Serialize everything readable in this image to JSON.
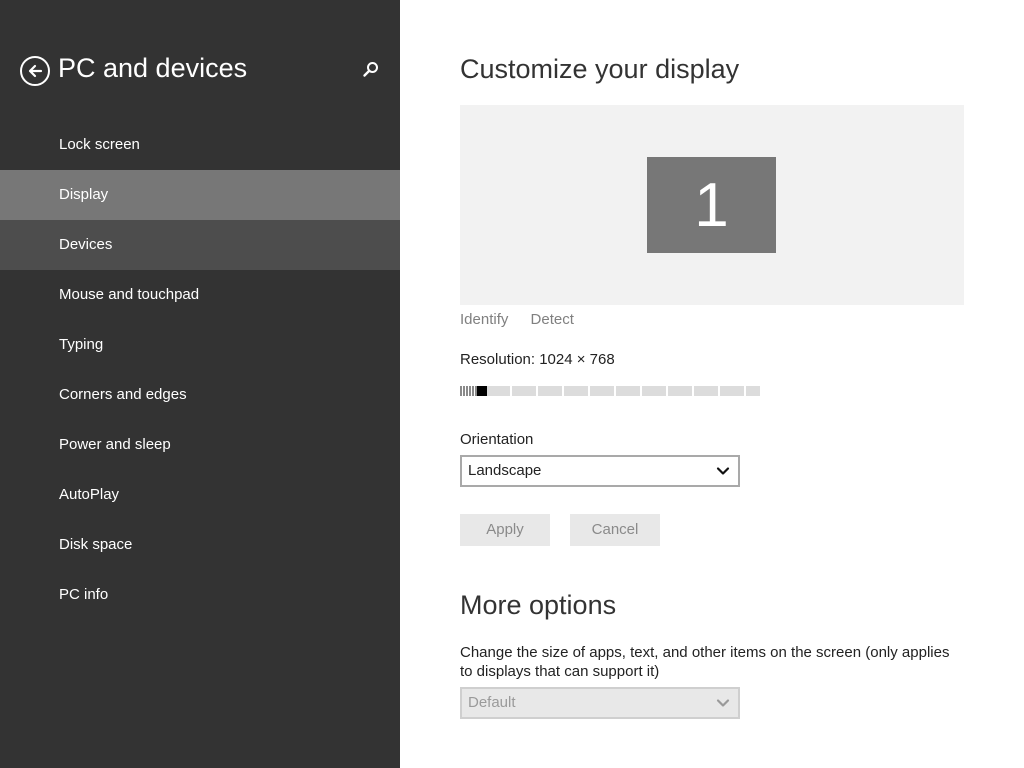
{
  "sidebar": {
    "title": "PC and devices",
    "back_icon": "back-arrow-icon",
    "search_icon": "search-icon",
    "items": [
      {
        "label": "Lock screen",
        "state": "normal"
      },
      {
        "label": "Display",
        "state": "selected"
      },
      {
        "label": "Devices",
        "state": "hover"
      },
      {
        "label": "Mouse and touchpad",
        "state": "normal"
      },
      {
        "label": "Typing",
        "state": "normal"
      },
      {
        "label": "Corners and edges",
        "state": "normal"
      },
      {
        "label": "Power and sleep",
        "state": "normal"
      },
      {
        "label": "AutoPlay",
        "state": "normal"
      },
      {
        "label": "Disk space",
        "state": "normal"
      },
      {
        "label": "PC info",
        "state": "normal"
      }
    ]
  },
  "main": {
    "title": "Customize your display",
    "monitor_number": "1",
    "identify_label": "Identify",
    "detect_label": "Detect",
    "resolution_label": "Resolution: 1024 × 768",
    "resolution_slider_level": 0.06,
    "orientation_label": "Orientation",
    "orientation_value": "Landscape",
    "apply_label": "Apply",
    "cancel_label": "Cancel",
    "more_options_title": "More options",
    "scale_description": "Change the size of apps, text, and other items on the screen (only applies to displays that can support it)",
    "scale_value": "Default"
  },
  "colors": {
    "sidebar_bg": "#333333",
    "selected_item_bg": "#777777",
    "hover_item_bg": "#4d4d4d",
    "monitor_bg": "#777777",
    "display_area_bg": "#f2f2f2"
  }
}
